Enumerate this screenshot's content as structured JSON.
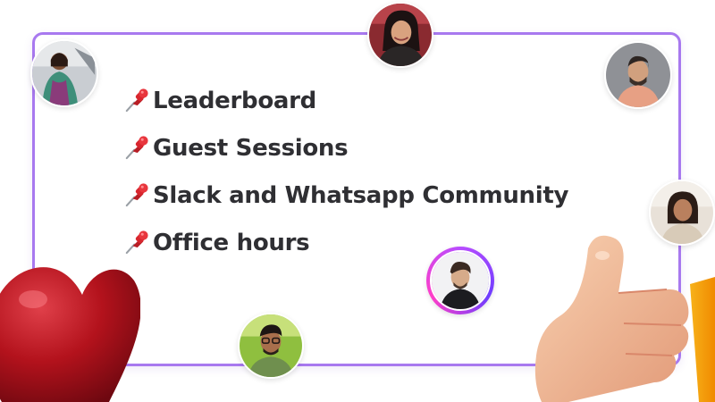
{
  "items": [
    {
      "label": "Leaderboard",
      "icon": "pushpin-icon"
    },
    {
      "label": "Guest Sessions",
      "icon": "pushpin-icon"
    },
    {
      "label": "Slack and Whatsapp Community",
      "icon": "pushpin-icon"
    },
    {
      "label": "Office hours",
      "icon": "pushpin-icon"
    }
  ],
  "colors": {
    "card_border": "#a879ef",
    "text": "#2f2f33",
    "pin_red": "#d8262e",
    "heart_red": "#b3121c",
    "thumb_skin": "#f2b994"
  },
  "decorations": {
    "heart": "heart-icon",
    "thumbs_up": "thumbs-up-icon"
  }
}
